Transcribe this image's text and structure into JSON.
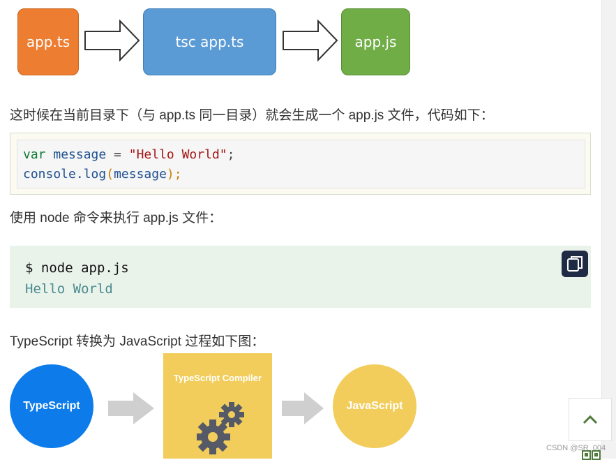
{
  "flow": {
    "box1": "app.ts",
    "box2": "tsc app.ts",
    "box3": "app.js",
    "colors": {
      "box1": "#ed7d31",
      "box2": "#5b9bd5",
      "box3": "#70ad47"
    }
  },
  "para1": "这时候在当前目录下（与 app.ts 同一目录）就会生成一个 app.js 文件，代码如下：",
  "code1": {
    "kw": "var",
    "varname": "message",
    "eq": " = ",
    "str": "\"Hello World\"",
    "semi": ";",
    "obj": "console.log",
    "open": "(",
    "arg": "message",
    "close": ");"
  },
  "para2": "使用 node 命令来执行 app.js 文件：",
  "code2": {
    "command": "$ node app.js",
    "output": "Hello World"
  },
  "copy_icon": "copy-icon",
  "para3": "TypeScript 转换为 JavaScript 过程如下图：",
  "diagram": {
    "left": "TypeScript",
    "middle": "TypeScript Compiler",
    "right": "JavaScript",
    "colors": {
      "left": "#0d7cea",
      "middle": "#f2cd5c",
      "right": "#f2cd5c"
    }
  },
  "back_to_top_icon": "chevron-up-icon",
  "watermark": "CSDN @SR_004"
}
